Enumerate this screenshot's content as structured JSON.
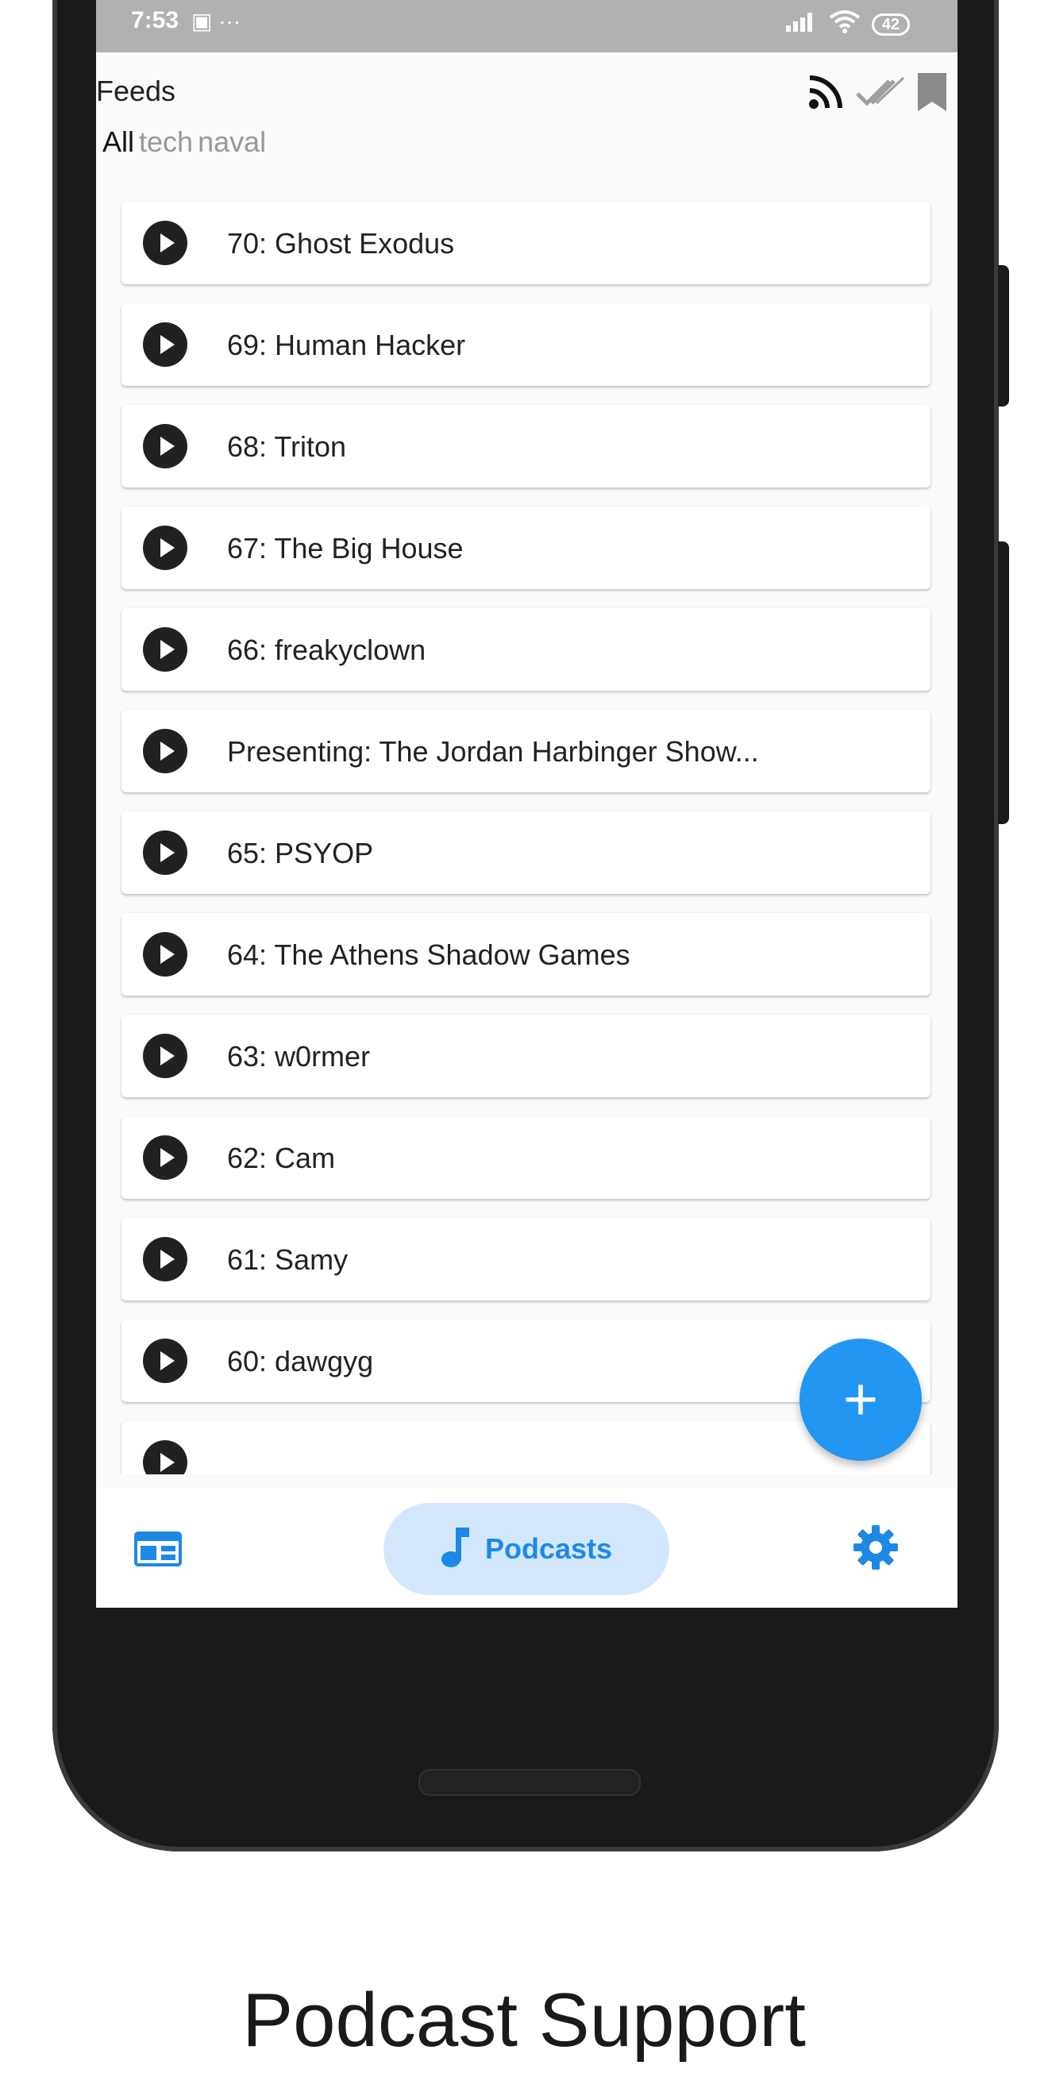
{
  "status_bar": {
    "time": "7:53",
    "left_icons": "▣ ···",
    "battery": "42"
  },
  "appbar": {
    "title": "Feeds",
    "actions": [
      "rss-icon",
      "double-check-icon",
      "bookmark-icon"
    ]
  },
  "tabs": [
    {
      "label": "All",
      "active": true
    },
    {
      "label": "tech",
      "active": false
    },
    {
      "label": "naval",
      "active": false
    }
  ],
  "episodes": [
    "",
    "70: Ghost Exodus",
    "69: Human Hacker",
    "68: Triton",
    "67: The Big House",
    "66: freakyclown",
    "Presenting: The Jordan Harbinger Show...",
    "65: PSYOP",
    "64: The Athens Shadow Games",
    "63: w0rmer",
    "62: Cam",
    "61: Samy",
    "60: dawgyg",
    ""
  ],
  "fab": {
    "icon": "+"
  },
  "bottom_nav": {
    "feeds_icon": "feeds-icon",
    "podcasts_label": "Podcasts",
    "settings_icon": "gear-icon"
  },
  "colors": {
    "accent": "#2196f3",
    "nav_pill": "#d3e8fc",
    "status_bar": "#b1b1b1"
  },
  "caption": "Podcast Support"
}
